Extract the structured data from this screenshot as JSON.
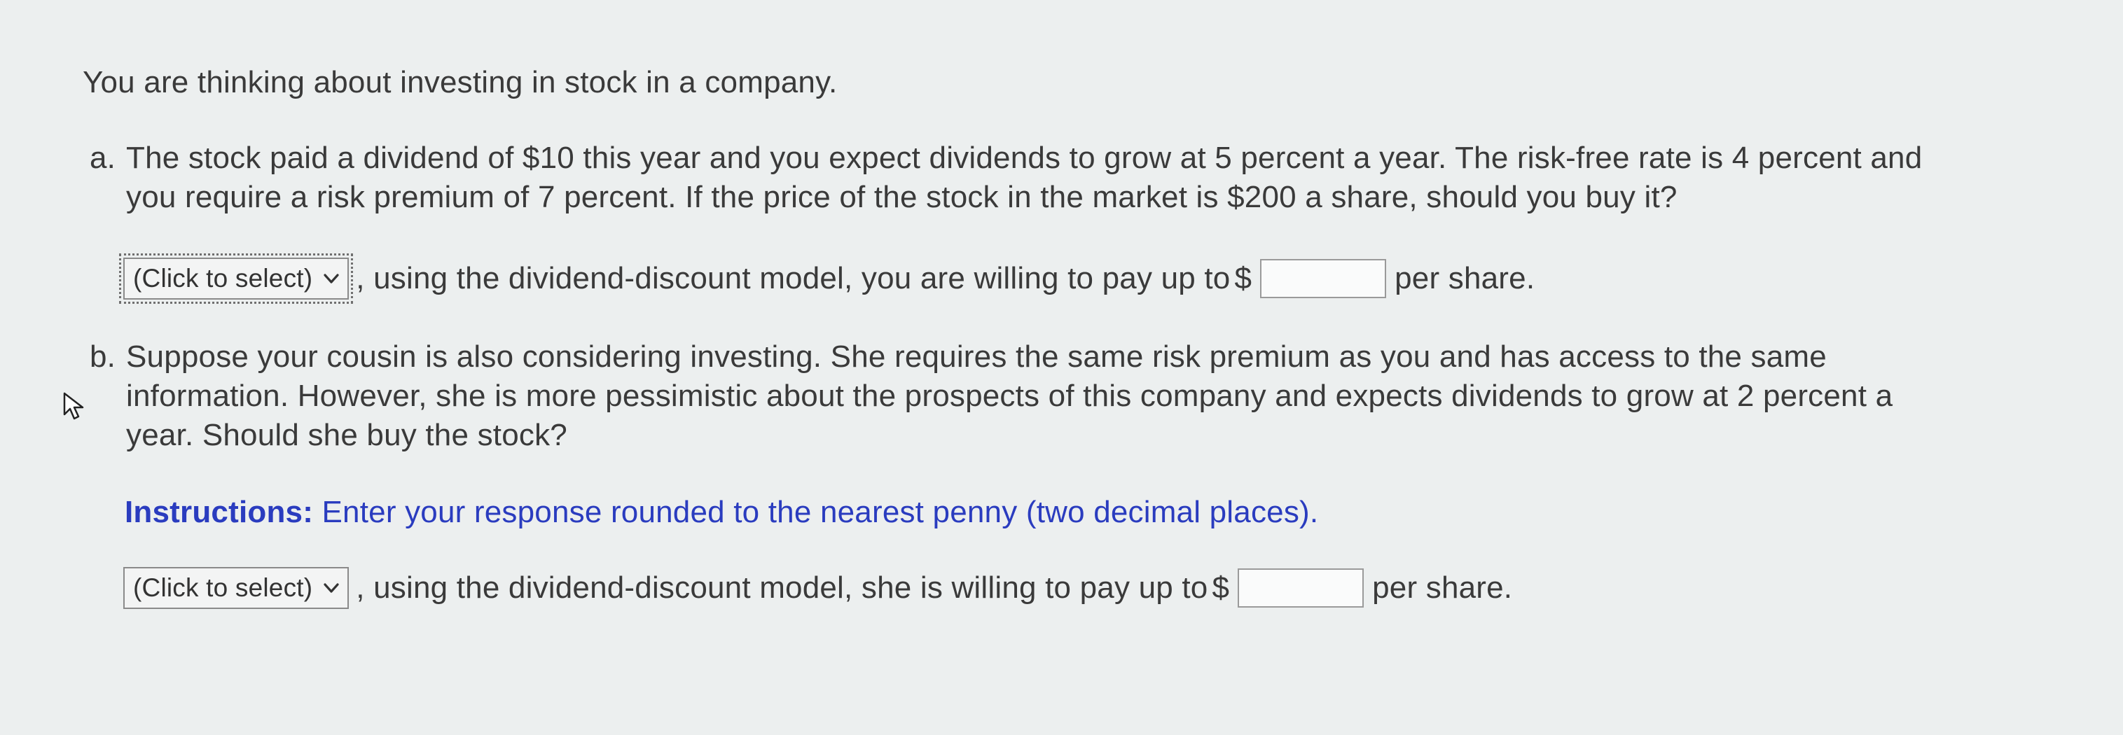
{
  "intro": "You are thinking about investing in stock in a company.",
  "part_a": {
    "letter": "a.",
    "lines": [
      "The stock paid a dividend of $10 this year and you expect dividends to grow at 5 percent a year. The risk-free rate is 4 percent and",
      "you require a risk premium of 7 percent. If the price of the stock in the market is $200 a share, should you buy it?"
    ],
    "select_label": "(Click to select)",
    "answer_text": ", using the dividend-discount model, you are willing to pay up to",
    "currency": "$",
    "input_value": "",
    "suffix": "per share."
  },
  "part_b": {
    "letter": "b.",
    "lines": [
      "Suppose your cousin is also considering investing. She requires the same risk premium as you and has access to the same",
      "information. However, she is more pessimistic about the prospects of this company and expects dividends to grow at 2 percent a",
      "year. Should she buy the stock?"
    ],
    "instructions_label": "Instructions:",
    "instructions_text": "Enter your response rounded to the nearest penny (two decimal places).",
    "select_label": "(Click to select)",
    "answer_text": ", using the dividend-discount model, she is willing to pay up to",
    "currency": "$",
    "input_value": "",
    "suffix": "per share."
  },
  "icons": {
    "dropdown": "chevron-down-icon",
    "cursor": "mouse-pointer-icon"
  },
  "colors": {
    "background": "#ecefef",
    "text": "#3a3a3a",
    "instructions": "#2a3cbf"
  }
}
